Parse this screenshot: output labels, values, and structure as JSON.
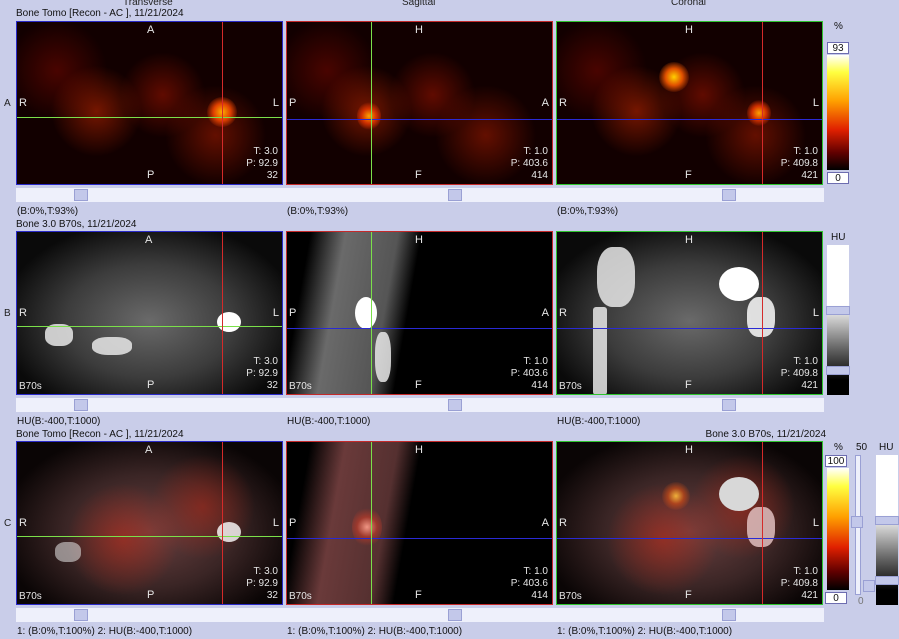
{
  "views": [
    "Transverse",
    "Sagittal",
    "Coronal"
  ],
  "rows": [
    {
      "letter": "A",
      "header": "Bone Tomo [Recon - AC ], 11/21/2024",
      "header_right": "",
      "kernel": "",
      "window": [
        "(B:0%,T:93%)",
        "(B:0%,T:93%)",
        "(B:0%,T:93%)"
      ],
      "panels": [
        {
          "top": "A",
          "bottom": "P",
          "left": "R",
          "right": "L",
          "t": "T: 3.0",
          "p": "P: 92.9",
          "n": "32"
        },
        {
          "top": "H",
          "bottom": "F",
          "left": "P",
          "right": "A",
          "t": "T: 1.0",
          "p": "P: 403.6",
          "n": "414"
        },
        {
          "top": "H",
          "bottom": "F",
          "left": "R",
          "right": "L",
          "t": "T: 1.0",
          "p": "P: 409.8",
          "n": "421"
        }
      ]
    },
    {
      "letter": "B",
      "header": "Bone  3.0  B70s, 11/21/2024",
      "header_right": "",
      "kernel": "B70s",
      "window": [
        "HU(B:-400,T:1000)",
        "HU(B:-400,T:1000)",
        "HU(B:-400,T:1000)"
      ],
      "panels": [
        {
          "top": "A",
          "bottom": "P",
          "left": "R",
          "right": "L",
          "t": "T: 3.0",
          "p": "P: 92.9",
          "n": "32"
        },
        {
          "top": "H",
          "bottom": "F",
          "left": "P",
          "right": "A",
          "t": "T: 1.0",
          "p": "P: 403.6",
          "n": "414"
        },
        {
          "top": "H",
          "bottom": "F",
          "left": "R",
          "right": "L",
          "t": "T: 1.0",
          "p": "P: 409.8",
          "n": "421"
        }
      ]
    },
    {
      "letter": "C",
      "header": "Bone Tomo [Recon - AC ], 11/21/2024",
      "header_right": "Bone  3.0  B70s, 11/21/2024",
      "kernel": "B70s",
      "window": [
        "1: (B:0%,T:100%)   2: HU(B:-400,T:1000)",
        "1: (B:0%,T:100%)   2: HU(B:-400,T:1000)",
        "1: (B:0%,T:100%)   2: HU(B:-400,T:1000)"
      ],
      "panels": [
        {
          "top": "A",
          "bottom": "P",
          "left": "R",
          "right": "L",
          "t": "T: 3.0",
          "p": "P: 92.9",
          "n": "32"
        },
        {
          "top": "H",
          "bottom": "F",
          "left": "P",
          "right": "A",
          "t": "T: 1.0",
          "p": "P: 403.6",
          "n": "414"
        },
        {
          "top": "H",
          "bottom": "F",
          "left": "R",
          "right": "L",
          "t": "T: 1.0",
          "p": "P: 409.8",
          "n": "421"
        }
      ]
    }
  ],
  "colorbars": {
    "a": {
      "unit": "%",
      "max": "93",
      "min": "0"
    },
    "b": {
      "unit": "HU"
    },
    "c": {
      "unit": "%",
      "max": "100",
      "min": "0",
      "fusion_max": "50",
      "fusion_min": "0",
      "unit2": "HU"
    }
  },
  "colors": {
    "crosshair_green": "#7be04a",
    "crosshair_red": "#d42a2a",
    "crosshair_blue": "#2a2ad4",
    "background": "#c9cde9"
  }
}
